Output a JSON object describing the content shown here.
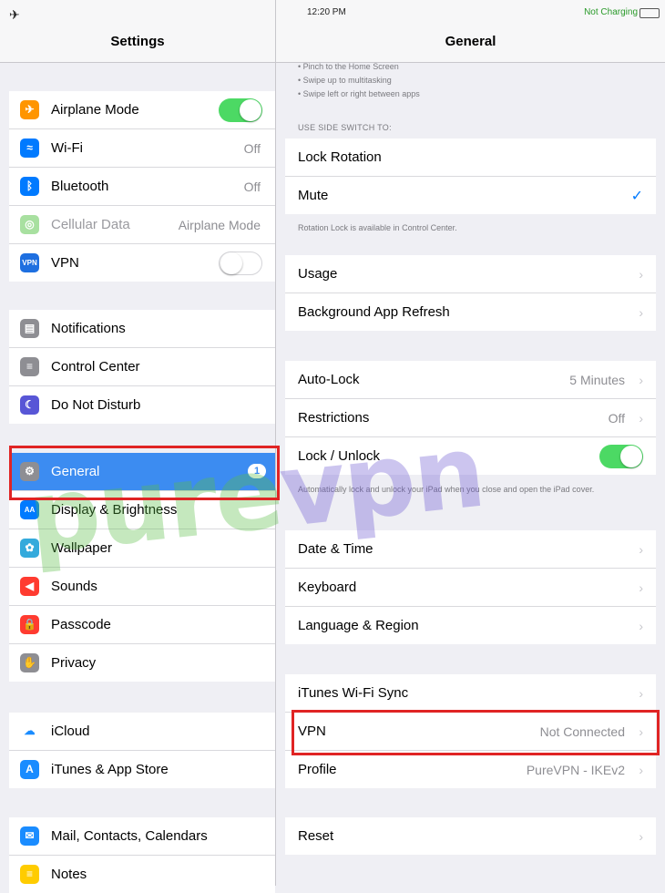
{
  "left_panel": {
    "title": "Settings",
    "status_left": "✈",
    "groups": [
      [
        {
          "label": "Airplane Mode",
          "icon": "airplane-icon",
          "color": "#ff9500",
          "glyph": "✈",
          "control": "toggle-on"
        },
        {
          "label": "Wi-Fi",
          "icon": "wifi-icon",
          "color": "#007aff",
          "glyph": "≈",
          "value": "Off"
        },
        {
          "label": "Bluetooth",
          "icon": "bluetooth-icon",
          "color": "#007aff",
          "glyph": "ᛒ",
          "value": "Off"
        },
        {
          "label": "Cellular Data",
          "icon": "cellular-icon",
          "color": "#a8e0a0",
          "glyph": "◎",
          "value": "Airplane Mode",
          "dimmed": true
        },
        {
          "label": "VPN",
          "icon": "vpn-icon",
          "color": "#1e6fe0",
          "glyph": "VPN",
          "control": "toggle-off"
        }
      ],
      [
        {
          "label": "Notifications",
          "icon": "notifications-icon",
          "color": "#8e8e93",
          "glyph": "▤"
        },
        {
          "label": "Control Center",
          "icon": "control-center-icon",
          "color": "#8e8e93",
          "glyph": "≡"
        },
        {
          "label": "Do Not Disturb",
          "icon": "moon-icon",
          "color": "#5856d6",
          "glyph": "☾"
        }
      ],
      [
        {
          "label": "General",
          "icon": "gear-icon",
          "color": "#8e8e93",
          "glyph": "⚙",
          "badge": "1",
          "selected": true
        },
        {
          "label": "Display & Brightness",
          "icon": "display-icon",
          "color": "#007aff",
          "glyph": "AA"
        },
        {
          "label": "Wallpaper",
          "icon": "wallpaper-icon",
          "color": "#34aadc",
          "glyph": "✿"
        },
        {
          "label": "Sounds",
          "icon": "sounds-icon",
          "color": "#ff3b30",
          "glyph": "◀"
        },
        {
          "label": "Passcode",
          "icon": "passcode-icon",
          "color": "#ff3b30",
          "glyph": "🔒"
        },
        {
          "label": "Privacy",
          "icon": "privacy-icon",
          "color": "#8e8e93",
          "glyph": "✋"
        }
      ],
      [
        {
          "label": "iCloud",
          "icon": "icloud-icon",
          "color": "#ffffff",
          "glyph": "☁",
          "glyph_color": "#1a8cff"
        },
        {
          "label": "iTunes & App Store",
          "icon": "app-store-icon",
          "color": "#1a8cff",
          "glyph": "A"
        }
      ],
      [
        {
          "label": "Mail, Contacts, Calendars",
          "icon": "mail-icon",
          "color": "#1a8cff",
          "glyph": "✉"
        },
        {
          "label": "Notes",
          "icon": "notes-icon",
          "color": "#ffcc00",
          "glyph": "≡"
        }
      ]
    ]
  },
  "right_panel": {
    "title": "General",
    "time": "12:20 PM",
    "charging": "Not Charging",
    "top_notes": [
      "• Pinch to the Home Screen",
      "• Swipe up to multitasking",
      "• Swipe left or right between apps"
    ],
    "side_switch_header": "USE SIDE SWITCH TO:",
    "side_switch": [
      {
        "label": "Lock Rotation"
      },
      {
        "label": "Mute",
        "checked": true
      }
    ],
    "side_switch_footer": "Rotation Lock is available in Control Center.",
    "usage_group": [
      {
        "label": "Usage"
      },
      {
        "label": "Background App Refresh"
      }
    ],
    "lock_group": [
      {
        "label": "Auto-Lock",
        "value": "5 Minutes"
      },
      {
        "label": "Restrictions",
        "value": "Off"
      },
      {
        "label": "Lock / Unlock",
        "control": "toggle-on"
      }
    ],
    "lock_footer": "Automatically lock and unlock your iPad when you close and open the iPad cover.",
    "date_group": [
      {
        "label": "Date & Time"
      },
      {
        "label": "Keyboard"
      },
      {
        "label": "Language & Region"
      }
    ],
    "sync_group": [
      {
        "label": "iTunes Wi-Fi Sync"
      },
      {
        "label": "VPN",
        "value": "Not Connected"
      },
      {
        "label": "Profile",
        "value": "PureVPN - IKEv2"
      }
    ],
    "reset_group": [
      {
        "label": "Reset"
      }
    ]
  },
  "watermark": {
    "pure": "pure",
    "vpn": "vpn"
  },
  "colors": {
    "accent": "#3c8cf1",
    "highlight": "#e02424",
    "toggle_on": "#4cd964"
  }
}
